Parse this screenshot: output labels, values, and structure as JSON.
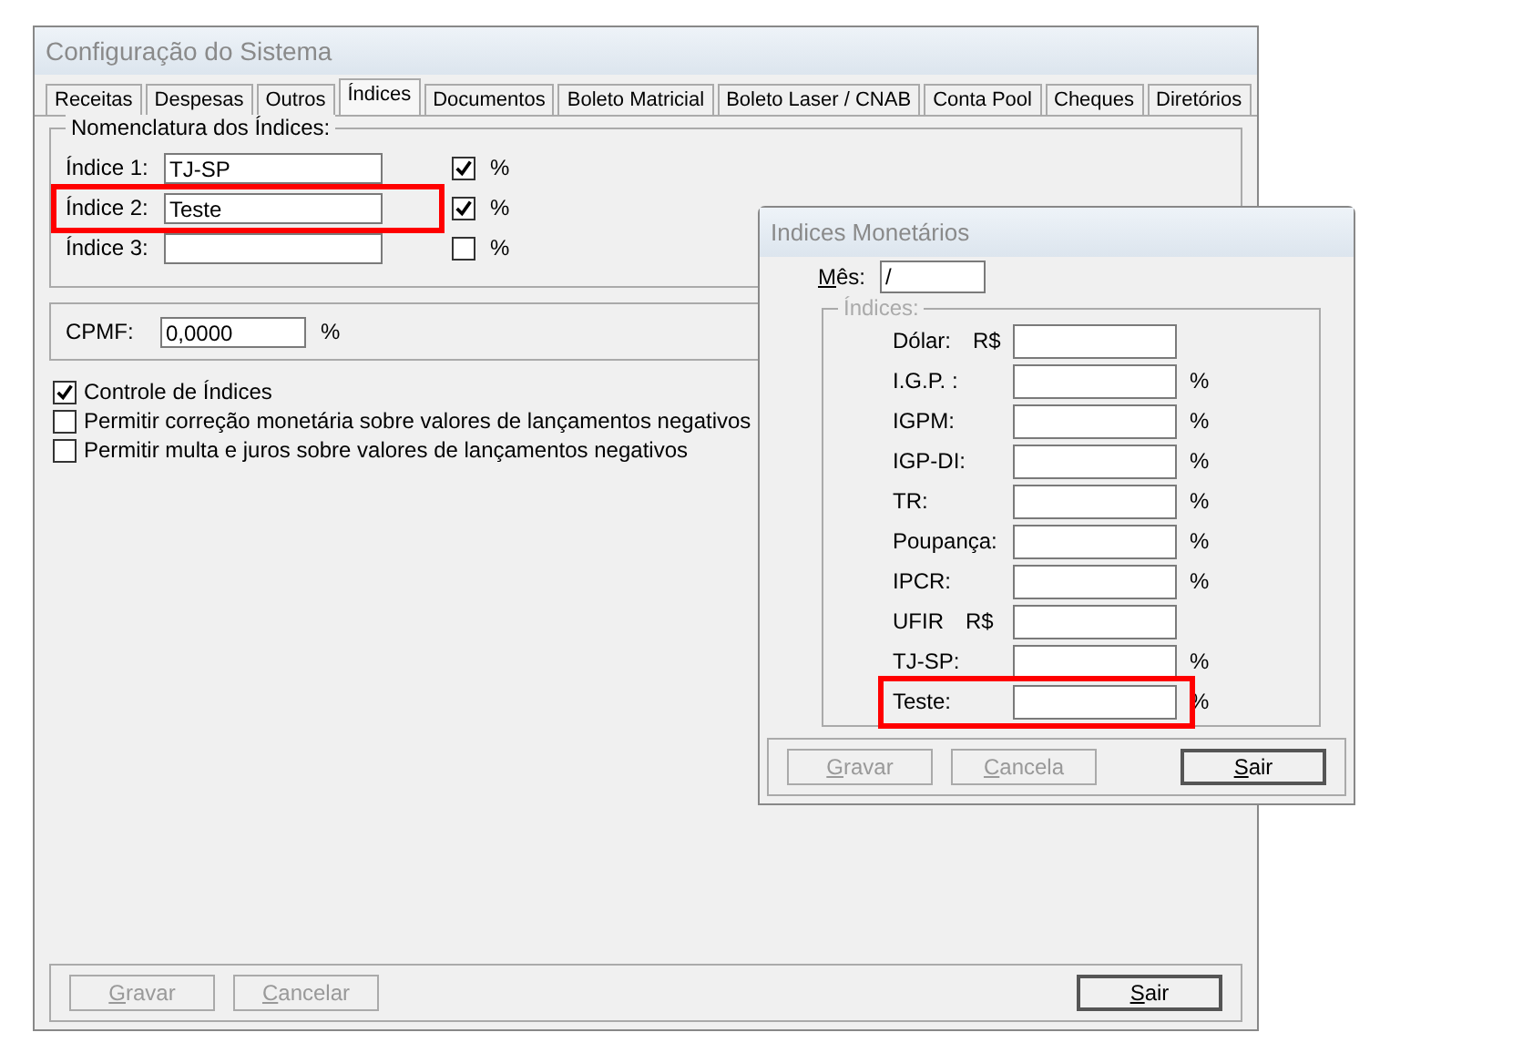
{
  "window": {
    "title": "Configuração do Sistema"
  },
  "tabs": [
    {
      "label": "Receitas",
      "selected": false
    },
    {
      "label": "Despesas",
      "selected": false
    },
    {
      "label": "Outros",
      "selected": false
    },
    {
      "label": "Índices",
      "selected": true
    },
    {
      "label": "Documentos",
      "selected": false
    },
    {
      "label": "Boleto Matricial",
      "selected": false
    },
    {
      "label": "Boleto Laser / CNAB",
      "selected": false
    },
    {
      "label": "Conta Pool",
      "selected": false
    },
    {
      "label": "Cheques",
      "selected": false
    },
    {
      "label": "Diretórios",
      "selected": false
    }
  ],
  "nomenclatura": {
    "title": "Nomenclatura dos Índices:",
    "rows": [
      {
        "label": "Índice 1:",
        "value": "TJ-SP",
        "checked": true,
        "suffix": "%",
        "highlighted": false
      },
      {
        "label": "Índice 2:",
        "value": "Teste",
        "checked": true,
        "suffix": "%",
        "highlighted": true
      },
      {
        "label": "Índice 3:",
        "value": "",
        "checked": false,
        "suffix": "%",
        "highlighted": false
      }
    ]
  },
  "cpmf": {
    "label": "CPMF:",
    "value": "0,0000",
    "suffix": "%"
  },
  "options": [
    {
      "label": "Controle de Índices",
      "checked": true
    },
    {
      "label": "Permitir correção monetária sobre valores de lançamentos negativos",
      "checked": false
    },
    {
      "label": "Permitir multa e juros sobre valores de lançamentos negativos",
      "checked": false
    }
  ],
  "buttons": [
    {
      "label": "Gravar",
      "disabled": true
    },
    {
      "label": "Cancelar",
      "disabled": true
    },
    {
      "label": "Sair",
      "disabled": false
    }
  ],
  "dialog": {
    "title": "Indices Monetários",
    "month_label": "Mês:",
    "month_value": "/",
    "group_title": "Índices:",
    "rows": [
      {
        "label": "Dólar:",
        "prefix": "R$",
        "suffix": "",
        "highlighted": false
      },
      {
        "label": "I.G.P. :",
        "prefix": "",
        "suffix": "%",
        "highlighted": false
      },
      {
        "label": "IGPM:",
        "prefix": "",
        "suffix": "%",
        "highlighted": false
      },
      {
        "label": "IGP-DI:",
        "prefix": "",
        "suffix": "%",
        "highlighted": false
      },
      {
        "label": "TR:",
        "prefix": "",
        "suffix": "%",
        "highlighted": false
      },
      {
        "label": "Poupança:",
        "prefix": "",
        "suffix": "%",
        "highlighted": false
      },
      {
        "label": "IPCR:",
        "prefix": "",
        "suffix": "%",
        "highlighted": false
      },
      {
        "label": "UFIR",
        "prefix": "R$",
        "suffix": "",
        "highlighted": false
      },
      {
        "label": "TJ-SP:",
        "prefix": "",
        "suffix": "%",
        "highlighted": false
      },
      {
        "label": "Teste:",
        "prefix": "",
        "suffix": "%",
        "highlighted": true
      }
    ],
    "buttons": [
      {
        "label": "Gravar",
        "disabled": true
      },
      {
        "label": "Cancela",
        "disabled": true
      },
      {
        "label": "Sair",
        "disabled": false
      }
    ]
  }
}
